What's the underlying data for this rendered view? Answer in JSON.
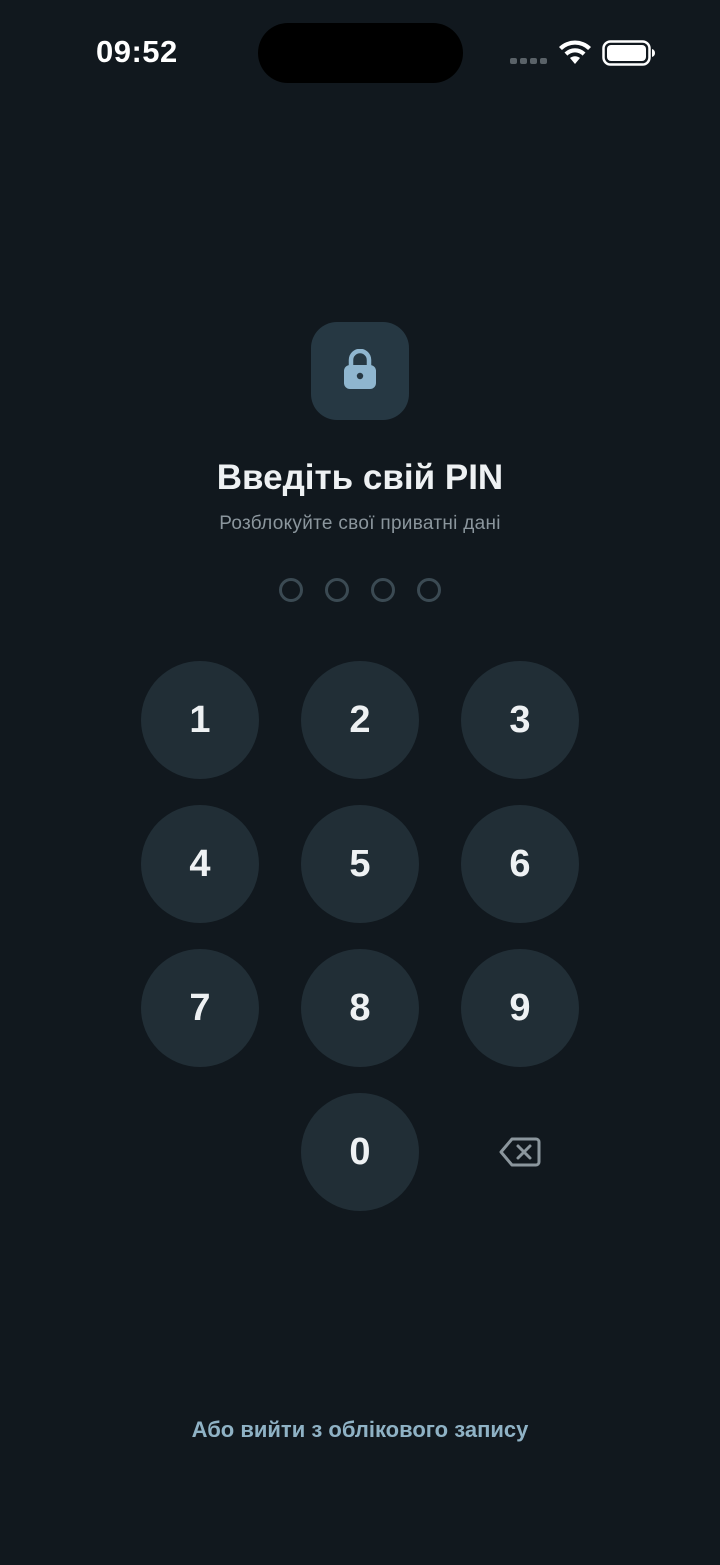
{
  "status_bar": {
    "time": "09:52",
    "icons": [
      "signal-icon",
      "wifi-icon",
      "battery-icon"
    ]
  },
  "lock": {
    "icon": "lock-icon",
    "tile_color": "#263843",
    "icon_color": "#8fb6cf"
  },
  "title": "Введіть свій PIN",
  "subtitle": "Розблокуйте свої приватні дані",
  "pin": {
    "length": 4,
    "filled": 0
  },
  "keypad": {
    "keys": [
      "1",
      "2",
      "3",
      "4",
      "5",
      "6",
      "7",
      "8",
      "9",
      "0"
    ],
    "backspace_icon": "backspace-icon"
  },
  "logout_link": "Або вийти з облікового запису",
  "colors": {
    "background": "#11181e",
    "key_background": "#212e36",
    "accent_link": "#8fb2c5"
  }
}
